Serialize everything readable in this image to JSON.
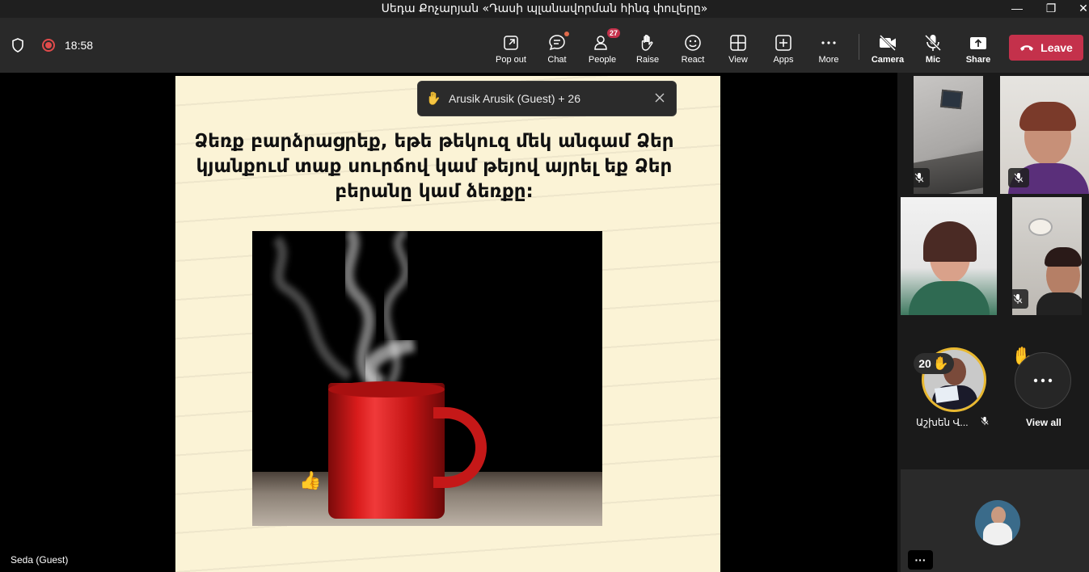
{
  "window": {
    "title": "Սեդա Քոչարյան «Դասի պլանավորման հինգ փուլերը»",
    "minimize": "—",
    "restore": "❐",
    "close": "✕"
  },
  "toolbar": {
    "time": "18:58",
    "buttons": [
      {
        "label": "Pop out",
        "icon": "pop-out-icon"
      },
      {
        "label": "Chat",
        "icon": "chat-icon"
      },
      {
        "label": "People",
        "icon": "people-icon",
        "badge": "27"
      },
      {
        "label": "Raise",
        "icon": "raise-hand-icon"
      },
      {
        "label": "React",
        "icon": "react-icon"
      },
      {
        "label": "View",
        "icon": "view-icon"
      },
      {
        "label": "Apps",
        "icon": "apps-icon"
      },
      {
        "label": "More",
        "icon": "more-icon"
      },
      {
        "label": "Camera",
        "icon": "camera-off-icon"
      },
      {
        "label": "Mic",
        "icon": "mic-off-icon"
      },
      {
        "label": "Share",
        "icon": "share-icon"
      }
    ],
    "leave_label": "Leave",
    "accent_color": "#c4314b"
  },
  "slide": {
    "lines": [
      "Ձեռք բարձրացրեք, եթե թեկուզ մեկ անգամ Ձեր",
      "կյանքում տաք սուրճով կամ թեյով այրել եք Ձեր",
      "բերանը կամ ձեռքը:"
    ],
    "reaction": "👍"
  },
  "raise_toast": {
    "text": "Arusik Arusik (Guest) + 26"
  },
  "presenter_name": "Seda (Guest)",
  "panel": {
    "avatar_count": "20",
    "avatar_name": "Աշխեն Վ...",
    "view_all": "View all",
    "more": "···"
  }
}
